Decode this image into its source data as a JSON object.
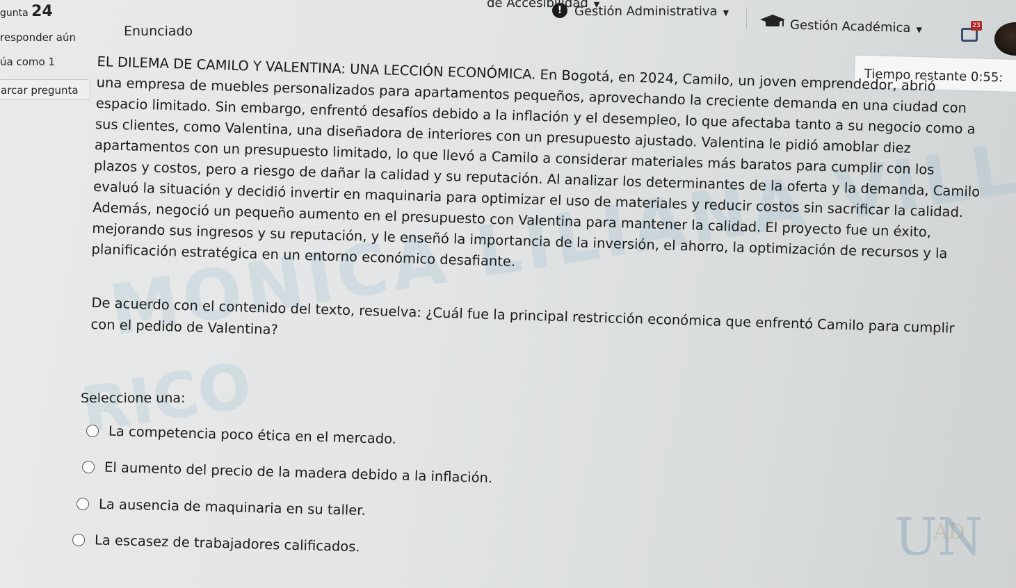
{
  "header": {
    "accessibility_label": "de Accesibilidad",
    "admin_menu_label": "Gestión Administrativa",
    "academic_menu_label": "Gestión Académica",
    "notification_count": "23"
  },
  "sidebar": {
    "question_prefix": "gunta",
    "question_number": "24",
    "status": "responder aún",
    "score": "úa como 1",
    "flag_label": "arcar pregunta"
  },
  "main": {
    "section_title": "Enunciado",
    "timer": "Tiempo restante 0:55:",
    "statement_lines": [
      "EL DILEMA DE CAMILO Y VALENTINA: UNA LECCIÓN ECONÓMICA. En Bogotá, en 2024, Camilo, un joven emprendedor, abrió",
      "una empresa de muebles personalizados para apartamentos pequeños, aprovechando la creciente demanda en una ciudad con",
      "espacio limitado. Sin embargo, enfrentó desafíos debido a la inflación y el desempleo, lo que afectaba tanto a su negocio como a",
      "sus clientes, como Valentina, una diseñadora de interiores con un presupuesto ajustado. Valentina le pidió amoblar diez",
      "apartamentos con un presupuesto limitado, lo que llevó a Camilo a considerar materiales más baratos para cumplir con los",
      "plazos y costos, pero a riesgo de dañar la calidad y su reputación. Al analizar los determinantes de la oferta y la demanda, Camilo",
      "evaluó la situación y decidió invertir en maquinaria para optimizar el uso de materiales y reducir costos sin sacrificar la calidad.",
      "Además, negoció un pequeño aumento en el presupuesto con Valentina para mantener la calidad. El proyecto fue un éxito,",
      "mejorando sus ingresos y su reputación, y le enseñó la importancia de la inversión, el ahorro, la optimización de recursos y la",
      "planificación estratégica en un entorno económico desafiante."
    ],
    "question_lines": [
      "De acuerdo con el contenido del texto, resuelva: ¿Cuál fue la principal restricción económica que enfrentó Camilo para cumplir",
      "con el pedido de Valentina?"
    ],
    "select_prompt": "Seleccione una:",
    "options": [
      "La competencia poco ética en el mercado.",
      "El aumento del precio de la madera debido a la inflación.",
      "La ausencia de maquinaria en su taller.",
      "La escasez de trabajadores calificados."
    ]
  },
  "watermark": {
    "line1": "MONICA LILIANA VILLAMARIN",
    "line2": "RICO"
  },
  "logo": {
    "text_main": "UN",
    "text_accent": "AD"
  }
}
